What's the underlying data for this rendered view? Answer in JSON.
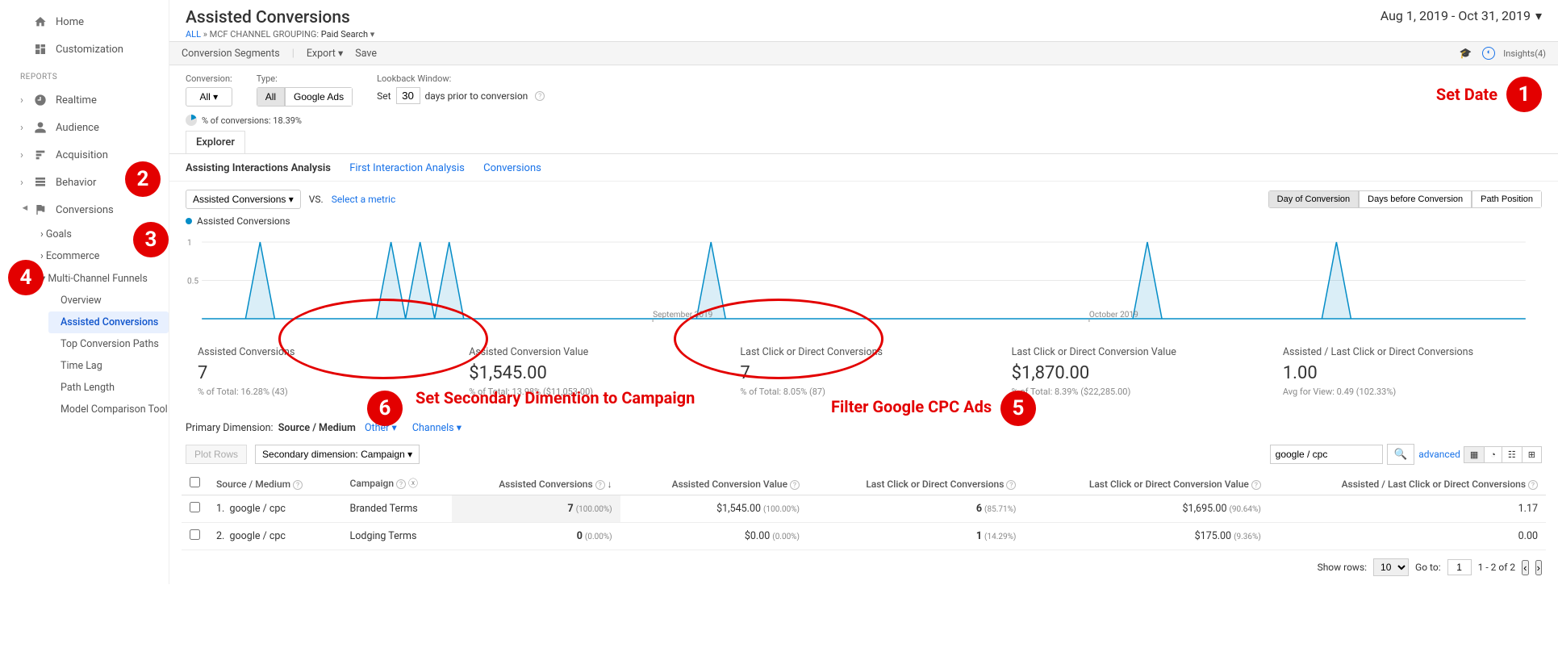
{
  "sidebar": {
    "home": "Home",
    "custom": "Customization",
    "reports_header": "REPORTS",
    "items": [
      "Realtime",
      "Audience",
      "Acquisition",
      "Behavior",
      "Conversions"
    ],
    "conv_children": [
      "Goals",
      "Ecommerce",
      "Multi-Channel Funnels"
    ],
    "mcf_children": [
      "Overview",
      "Assisted Conversions",
      "Top Conversion Paths",
      "Time Lag",
      "Path Length",
      "Model Comparison Tool"
    ],
    "active_leaf": "Assisted Conversions"
  },
  "header": {
    "title": "Assisted Conversions",
    "bc_all": "ALL",
    "bc_sep": " » ",
    "bc_label": "MCF CHANNEL GROUPING:",
    "bc_value": "Paid Search",
    "date": "Aug 1, 2019 - Oct 31, 2019"
  },
  "toolbar": {
    "conv_seg": "Conversion Segments",
    "export": "Export",
    "save": "Save",
    "insights": "Insights(4)"
  },
  "controls": {
    "conversion_label": "Conversion:",
    "conversion_value": "All",
    "type_label": "Type:",
    "type_all": "All",
    "type_gads": "Google Ads",
    "lookback_label": "Lookback Window:",
    "lookback_pre": "Set",
    "lookback_days": "30",
    "lookback_post": "days prior to conversion",
    "pct_line": "% of conversions: 18.39%"
  },
  "tabs": {
    "explorer": "Explorer",
    "sub": [
      "Assisting Interactions Analysis",
      "First Interaction Analysis",
      "Conversions"
    ],
    "active_sub": 0
  },
  "chart_controls": {
    "metric_dd": "Assisted Conversions",
    "vs": "VS.",
    "select_metric": "Select a metric",
    "granularity": [
      "Day of Conversion",
      "Days before Conversion",
      "Path Position"
    ],
    "active_gran": 0,
    "legend": "Assisted Conversions"
  },
  "chart_data": {
    "type": "line",
    "title": "Assisted Conversions",
    "series_name": "Assisted Conversions",
    "x": [
      0,
      1,
      2,
      3,
      4,
      5,
      6,
      7,
      8,
      9,
      10,
      11,
      12,
      13,
      14,
      15,
      16,
      17,
      18,
      19,
      20,
      21,
      22,
      23,
      24,
      25,
      26,
      27,
      28,
      29,
      30,
      31,
      32,
      33,
      34,
      35,
      36,
      37,
      38,
      39,
      40,
      41,
      42,
      43,
      44,
      45,
      46,
      47,
      48,
      49,
      50,
      51,
      52,
      53,
      54,
      55,
      56,
      57,
      58,
      59,
      60,
      61,
      62,
      63,
      64,
      65,
      66,
      67,
      68,
      69,
      70,
      71,
      72,
      73,
      74,
      75,
      76,
      77,
      78,
      79,
      80,
      81,
      82,
      83,
      84,
      85,
      86,
      87,
      88,
      89,
      90,
      91
    ],
    "values": [
      0,
      0,
      0,
      0,
      1,
      0,
      0,
      0,
      0,
      0,
      0,
      0,
      0,
      1,
      0,
      1,
      0,
      1,
      0,
      0,
      0,
      0,
      0,
      0,
      0,
      0,
      0,
      0,
      0,
      0,
      0,
      0,
      0,
      0,
      0,
      1,
      0,
      0,
      0,
      0,
      0,
      0,
      0,
      0,
      0,
      0,
      0,
      0,
      0,
      0,
      0,
      0,
      0,
      0,
      0,
      0,
      0,
      0,
      0,
      0,
      0,
      0,
      0,
      0,
      0,
      1,
      0,
      0,
      0,
      0,
      0,
      0,
      0,
      0,
      0,
      0,
      0,
      0,
      1,
      0,
      0,
      0,
      0,
      0,
      0,
      0,
      0,
      0,
      0,
      0,
      0,
      0
    ],
    "ylim": [
      0,
      1
    ],
    "ticks_y": [
      0.5,
      1
    ],
    "month_labels": [
      {
        "x": 31,
        "label": "September 2019"
      },
      {
        "x": 61,
        "label": "October 2019"
      }
    ]
  },
  "summary": [
    {
      "label": "Assisted Conversions",
      "value": "7",
      "sub": "% of Total: 16.28% (43)"
    },
    {
      "label": "Assisted Conversion Value",
      "value": "$1,545.00",
      "sub": "% of Total: 13.98% ($11,053.00)"
    },
    {
      "label": "Last Click or Direct Conversions",
      "value": "7",
      "sub": "% of Total: 8.05% (87)"
    },
    {
      "label": "Last Click or Direct Conversion Value",
      "value": "$1,870.00",
      "sub": "% of Total: 8.39% ($22,285.00)"
    },
    {
      "label": "Assisted / Last Click or Direct Conversions",
      "value": "1.00",
      "sub": "Avg for View: 0.49 (102.33%)"
    }
  ],
  "dimensions": {
    "label": "Primary Dimension:",
    "items": [
      "Source / Medium",
      "Other",
      "Channels"
    ],
    "active": 0,
    "plot_rows": "Plot Rows",
    "secondary": "Secondary dimension: Campaign",
    "search_value": "google / cpc",
    "advanced": "advanced"
  },
  "table": {
    "cols": [
      "Source / Medium",
      "Campaign",
      "Assisted Conversions",
      "Assisted Conversion Value",
      "Last Click or Direct Conversions",
      "Last Click or Direct Conversion Value",
      "Assisted / Last Click or Direct Conversions"
    ],
    "rows": [
      {
        "n": "1.",
        "source": "google / cpc",
        "campaign": "Branded Terms",
        "ac": "7",
        "ac_pct": "(100.00%)",
        "acv": "$1,545.00",
        "acv_pct": "(100.00%)",
        "lc": "6",
        "lc_pct": "(85.71%)",
        "lcv": "$1,695.00",
        "lcv_pct": "(90.64%)",
        "ratio": "1.17"
      },
      {
        "n": "2.",
        "source": "google / cpc",
        "campaign": "Lodging Terms",
        "ac": "0",
        "ac_pct": "(0.00%)",
        "acv": "$0.00",
        "acv_pct": "(0.00%)",
        "lc": "1",
        "lc_pct": "(14.29%)",
        "lcv": "$175.00",
        "lcv_pct": "(9.36%)",
        "ratio": "0.00"
      }
    ]
  },
  "pager": {
    "show_rows": "Show rows:",
    "rows": "10",
    "goto": "Go to:",
    "goto_v": "1",
    "range": "1 - 2 of 2"
  },
  "annotations": {
    "b1": "Set Date",
    "b5": "Filter Google CPC Ads",
    "b6": "Set Secondary Dimention to Campaign"
  }
}
